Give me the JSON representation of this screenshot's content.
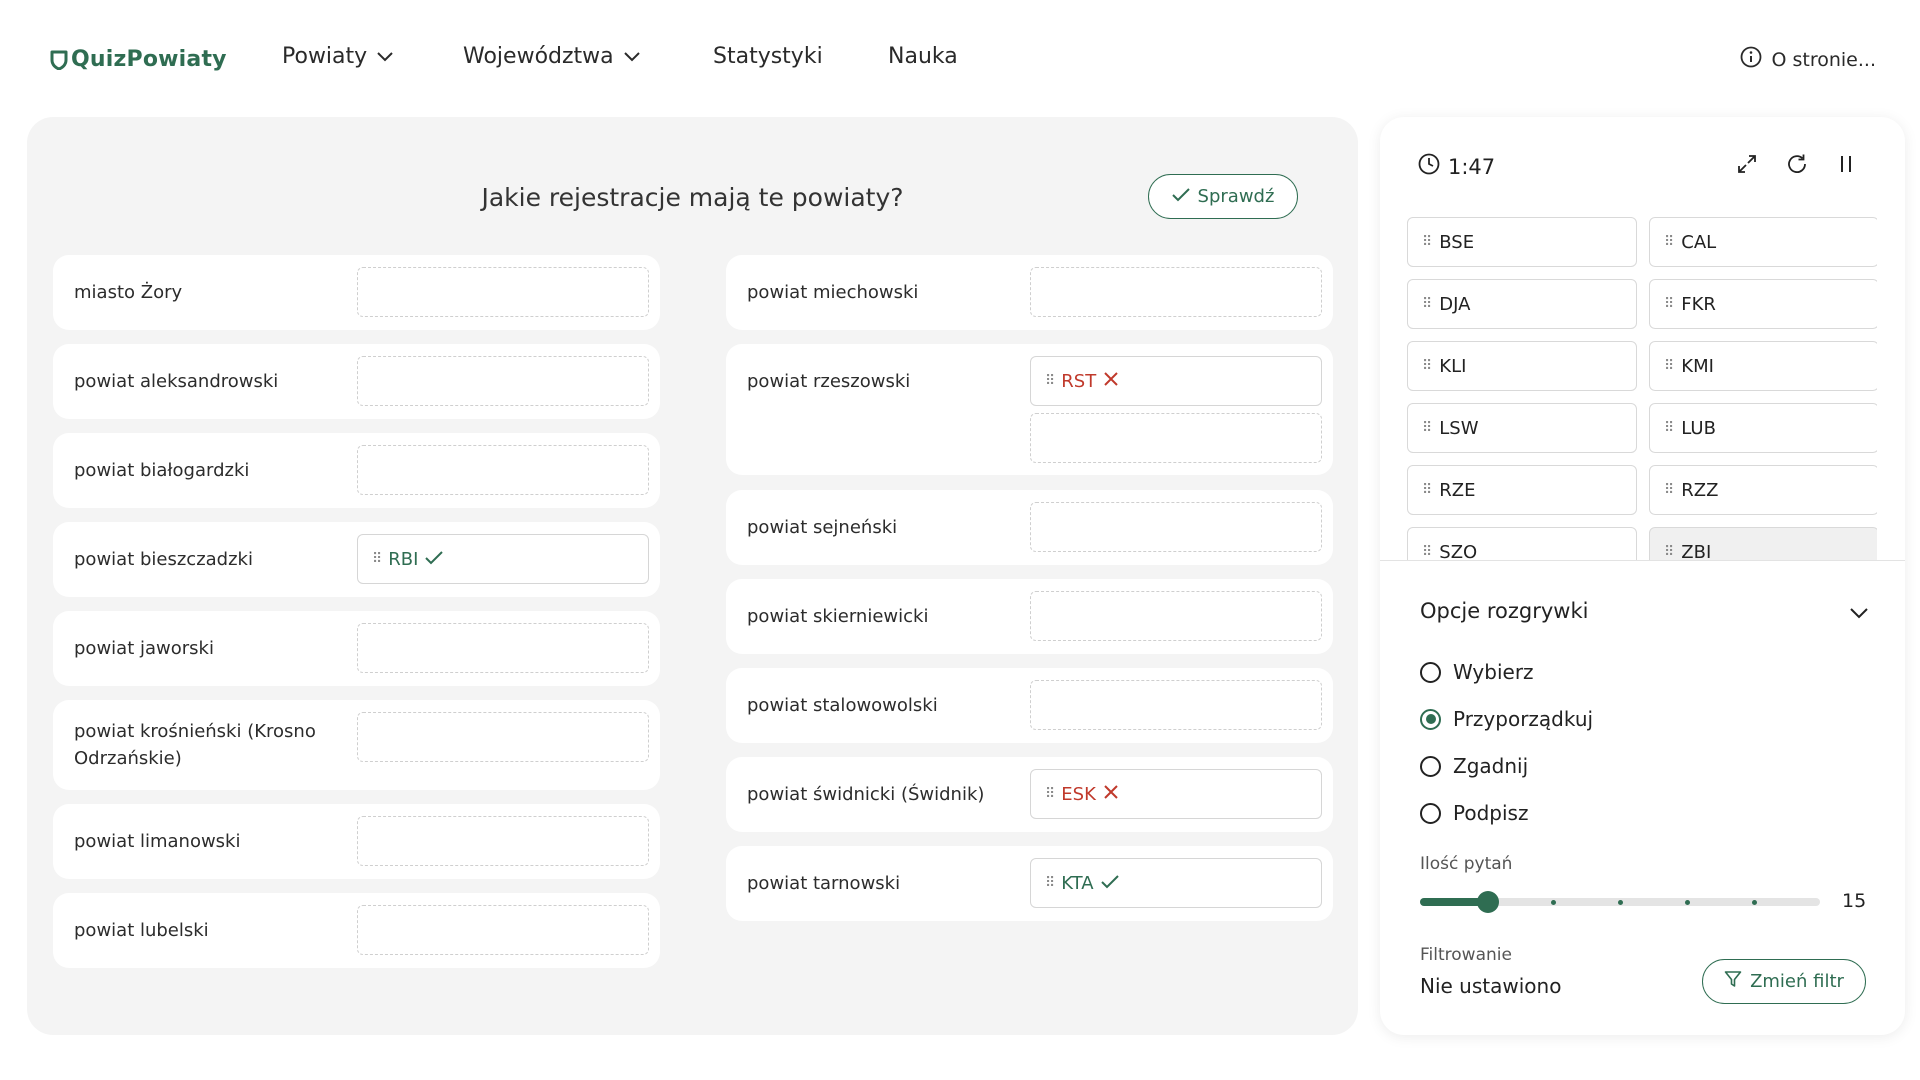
{
  "header": {
    "logo_text": "QuizPowiaty",
    "nav": [
      {
        "label": "Powiaty",
        "dropdown": true
      },
      {
        "label": "Województwa",
        "dropdown": true
      },
      {
        "label": "Statystyki",
        "dropdown": false
      },
      {
        "label": "Nauka",
        "dropdown": false
      }
    ],
    "about_label": "O stronie..."
  },
  "quiz": {
    "question": "Jakie rejestracje mają te powiaty?",
    "check_label": "Sprawdź",
    "left_column": [
      {
        "label": "miasto Żory",
        "answers": []
      },
      {
        "label": "powiat aleksandrowski",
        "answers": []
      },
      {
        "label": "powiat białogardzki",
        "answers": []
      },
      {
        "label": "powiat bieszczadzki",
        "answers": [
          {
            "code": "RBI",
            "status": "correct"
          }
        ]
      },
      {
        "label": "powiat jaworski",
        "answers": []
      },
      {
        "label": "powiat krośnieński (Krosno Odrzańskie)",
        "answers": []
      },
      {
        "label": "powiat limanowski",
        "answers": []
      },
      {
        "label": "powiat lubelski",
        "answers": []
      }
    ],
    "right_column": [
      {
        "label": "powiat miechowski",
        "answers": []
      },
      {
        "label": "powiat rzeszowski",
        "answers": [
          {
            "code": "RST",
            "status": "wrong"
          }
        ]
      },
      {
        "label": "powiat sejneński",
        "answers": []
      },
      {
        "label": "powiat skierniewicki",
        "answers": []
      },
      {
        "label": "powiat stalowowolski",
        "answers": []
      },
      {
        "label": "powiat świdnicki (Świdnik)",
        "answers": [
          {
            "code": "ESK",
            "status": "wrong"
          }
        ]
      },
      {
        "label": "powiat tarnowski",
        "answers": [
          {
            "code": "KTA",
            "status": "correct"
          }
        ]
      }
    ]
  },
  "side": {
    "timer": "1:47",
    "tools": [
      "expand-icon",
      "restart-icon",
      "pause-icon"
    ],
    "tiles": [
      {
        "code": "BSE",
        "used": false
      },
      {
        "code": "CAL",
        "used": false
      },
      {
        "code": "DJA",
        "used": false
      },
      {
        "code": "FKR",
        "used": false
      },
      {
        "code": "KLI",
        "used": false
      },
      {
        "code": "KMI",
        "used": false
      },
      {
        "code": "LSW",
        "used": false
      },
      {
        "code": "LUB",
        "used": false
      },
      {
        "code": "RZE",
        "used": false
      },
      {
        "code": "RZZ",
        "used": false
      },
      {
        "code": "SZO",
        "used": false
      },
      {
        "code": "ZBI",
        "used": true
      }
    ],
    "options_title": "Opcje rozgrywki",
    "modes": [
      {
        "label": "Wybierz",
        "selected": false
      },
      {
        "label": "Przyporządkuj",
        "selected": true
      },
      {
        "label": "Zgadnij",
        "selected": false
      },
      {
        "label": "Podpisz",
        "selected": false
      }
    ],
    "questions_label": "Ilość pytań",
    "questions_value": "15",
    "questions_slider_fraction": 0.17,
    "filter_label": "Filtrowanie",
    "filter_value": "Nie ustawiono",
    "filter_button": "Zmień filtr"
  },
  "colors": {
    "accent": "#2f6d52",
    "error": "#c0392b",
    "panel_bg": "#f4f4f4"
  }
}
